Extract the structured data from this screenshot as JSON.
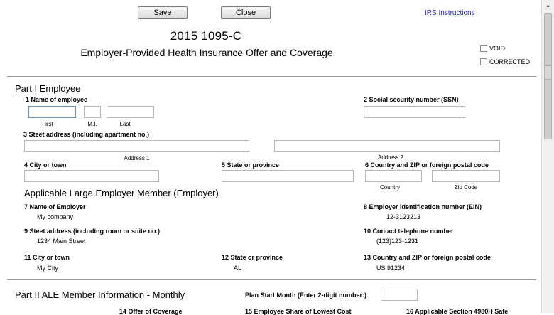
{
  "toolbar": {
    "save_label": "Save",
    "close_label": "Close",
    "irs_link": "IRS Instructions"
  },
  "header": {
    "form_title": "2015 1095-C",
    "form_subtitle": "Employer-Provided Health Insurance Offer and Coverage",
    "void_label": "VOID",
    "corrected_label": "CORRECTED"
  },
  "part1": {
    "heading": "Part I Employee",
    "name_label": "1 Name of employee",
    "first_sub": "First",
    "mi_sub": "M.I.",
    "last_sub": "Last",
    "ssn_label": "2 Social security number (SSN)",
    "address_label": "3 Steet address (including apartment no.)",
    "address1_sub": "Address 1",
    "address2_sub": "Address 2",
    "city_label": "4 City or town",
    "state_label": "5 State or province",
    "country_zip_label": "6 Country and ZIP or foreign postal code",
    "country_sub": "Country",
    "zip_sub": "Zip Code"
  },
  "employer": {
    "heading": "Applicable Large Employer Member (Employer)",
    "name_label": "7 Name of Employer",
    "name_value": "My company",
    "ein_label": "8 Employer identification number (EIN)",
    "ein_value": "12-3123213",
    "address_label": "9 Steet address (including room or suite no.)",
    "address_value": "1234 Main Street",
    "phone_label": "10 Contact telephone number",
    "phone_value": "(123)123-1231",
    "city_label": "11 City or town",
    "city_value": "My City",
    "state_label": "12 State or province",
    "state_value": "AL",
    "country_zip_label": "13 Country and ZIP or foreign postal code",
    "country_zip_value": "US 91234"
  },
  "part2": {
    "heading": "Part II ALE Member Information - Monthly",
    "plan_start_label": "Plan Start Month (Enter 2-digit number:)",
    "col14": "14 Offer of Coverage",
    "col15": "15 Employee Share of Lowest Cost",
    "col16": "16 Applicable Section 4980H Safe"
  }
}
